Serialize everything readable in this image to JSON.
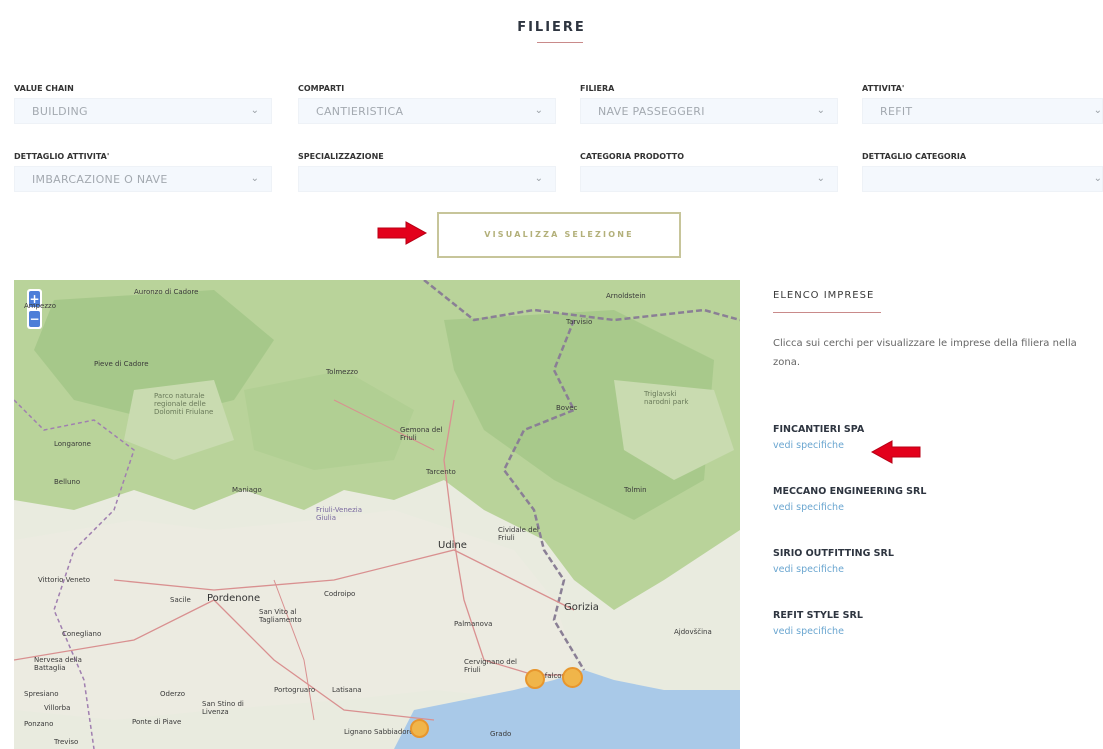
{
  "page": {
    "title": "FILIERE"
  },
  "filters": [
    {
      "label": "VALUE CHAIN",
      "value": "BUILDING"
    },
    {
      "label": "COMPARTI",
      "value": "CANTIERISTICA"
    },
    {
      "label": "FILIERA",
      "value": "NAVE PASSEGGERI"
    },
    {
      "label": "ATTIVITA'",
      "value": "REFIT"
    },
    {
      "label": "DETTAGLIO ATTIVITA'",
      "value": "IMBARCAZIONE O NAVE"
    },
    {
      "label": "SPECIALIZZAZIONE",
      "value": ""
    },
    {
      "label": "CATEGORIA PRODOTTO",
      "value": ""
    },
    {
      "label": "DETTAGLIO CATEGORIA",
      "value": ""
    }
  ],
  "actions": {
    "visualize_label": "VISUALIZZA SELEZIONE"
  },
  "map": {
    "zoom_in": "+",
    "zoom_out": "−",
    "places": [
      "Ampezzo",
      "Auronzo di Cadore",
      "Arnoldstein",
      "Tarvisio",
      "Pieve di Cadore",
      "Tolmezzo",
      "Parco naturale regionale delle Dolomiti Friulane",
      "Longarone",
      "Bovec",
      "Triglavski narodni park",
      "Gemona del Friuli",
      "Tarcento",
      "Maniago",
      "Belluno",
      "Friuli-Venezia Giulia",
      "Cividale del Friuli",
      "Udine",
      "Tolmin",
      "Vittorio Veneto",
      "Sacile",
      "Pordenone",
      "Codroipo",
      "San Vito al Tagliamento",
      "Palmanova",
      "Gorizia",
      "Ajdovščina",
      "Conegliano",
      "Nervesa della Battaglia",
      "Cervignano del Friuli",
      "Oderzo",
      "Portogruaro",
      "Latisana",
      "San Stino di Livenza",
      "Spresiano",
      "Villorba",
      "Ponzano",
      "Ponte di Piave",
      "Treviso",
      "Lignano Sabbiadoro",
      "Grado",
      "Monfalcone"
    ]
  },
  "sidebar": {
    "heading": "ELENCO IMPRESE",
    "description": "Clicca sui cerchi per visualizzare le imprese della filiera nella zona.",
    "companies": [
      {
        "name": "FINCANTIERI SPA",
        "link": "vedi specifiche"
      },
      {
        "name": "MECCANO ENGINEERING SRL",
        "link": "vedi specifiche"
      },
      {
        "name": "SIRIO OUTFITTING SRL",
        "link": "vedi specifiche"
      },
      {
        "name": "REFIT STYLE SRL",
        "link": "vedi specifiche"
      }
    ]
  },
  "colors": {
    "arrow": "#e3001b",
    "button_border": "#c7c59a",
    "link": "#6aa6d0",
    "marker": "#f0b54a"
  }
}
